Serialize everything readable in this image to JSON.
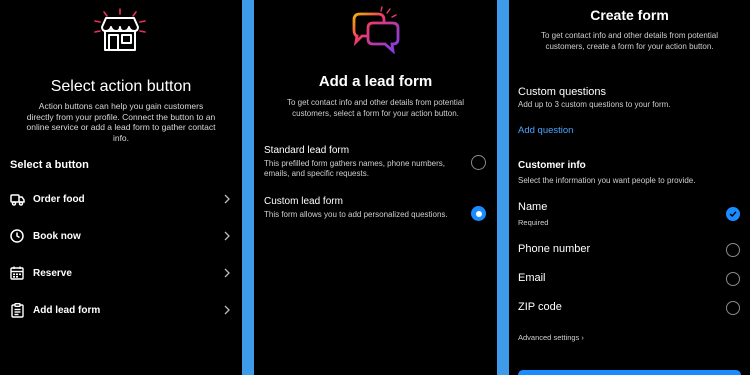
{
  "panel1": {
    "title": "Select action button",
    "description": "Action buttons can help you gain customers directly from your profile. Connect the button to an online service or add a lead form to gather contact info.",
    "section_label": "Select a button",
    "items": [
      {
        "label": "Order food",
        "icon": "delivery-truck-icon"
      },
      {
        "label": "Book now",
        "icon": "clock-icon"
      },
      {
        "label": "Reserve",
        "icon": "calendar-icon"
      },
      {
        "label": "Add lead form",
        "icon": "clipboard-icon"
      }
    ]
  },
  "panel2": {
    "title": "Add a lead form",
    "description": "To get contact info and other details from potential customers, select a form for your action button.",
    "options": [
      {
        "title": "Standard lead form",
        "description": "This prefilled form gathers names, phone numbers, emails, and specific requests.",
        "selected": false
      },
      {
        "title": "Custom lead form",
        "description": "This form allows you to add personalized questions.",
        "selected": true
      }
    ]
  },
  "panel3": {
    "title": "Create form",
    "description": "To get contact info and other details from potential customers, create a form for your action button.",
    "custom_questions_title": "Custom questions",
    "custom_questions_sub": "Add up to 3 custom questions to your form.",
    "add_question": "Add question",
    "customer_info_title": "Customer info",
    "customer_info_sub": "Select the information you want people to provide.",
    "fields": [
      {
        "label": "Name",
        "sub": "Required",
        "checked": true
      },
      {
        "label": "Phone number",
        "sub": "",
        "checked": false
      },
      {
        "label": "Email",
        "sub": "",
        "checked": false
      },
      {
        "label": "ZIP code",
        "sub": "",
        "checked": false
      }
    ],
    "advanced": "Advanced settings ›"
  },
  "colors": {
    "accent": "#1a8cff",
    "link": "#4aa3ff",
    "background": "#3d9be9"
  }
}
